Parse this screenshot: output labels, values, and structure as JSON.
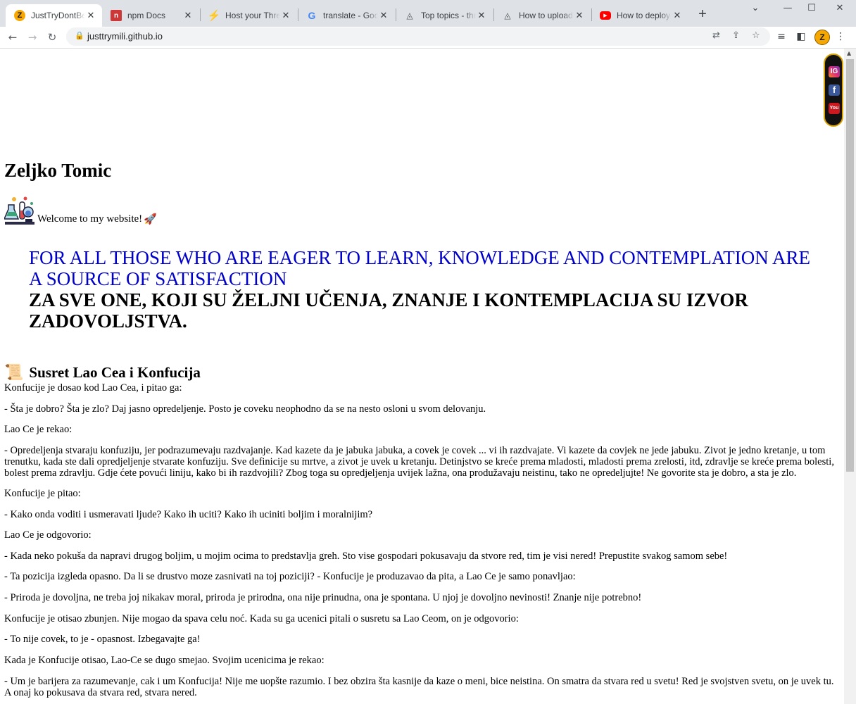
{
  "browser": {
    "tabs": [
      {
        "title": "JustTryDontBeShy",
        "active": true,
        "favicon": "z-logo-icon",
        "color": "#f6a800"
      },
      {
        "title": "npm Docs",
        "active": false,
        "favicon": "npm-icon",
        "color": "#cb3837"
      },
      {
        "title": "Host your Three.js",
        "active": false,
        "favicon": "lightning-icon",
        "color": "#f5a623"
      },
      {
        "title": "translate - Google",
        "active": false,
        "favicon": "google-icon",
        "color": "#4285f4"
      },
      {
        "title": "Top topics - three",
        "active": false,
        "favicon": "three-logo-icon",
        "color": "#555555"
      },
      {
        "title": "How to upload the",
        "active": false,
        "favicon": "three-logo-icon",
        "color": "#555555"
      },
      {
        "title": "How to deploy a T",
        "active": false,
        "favicon": "youtube-icon",
        "color": "#ff0000"
      }
    ],
    "url": "justtrymili.github.io",
    "profile_initial": "Z"
  },
  "page": {
    "name": "Zeljko Tomic",
    "welcome": "Welcome to my website!",
    "quote_en": "FOR ALL THOSE WHO ARE EAGER TO LEARN, KNOWLEDGE AND CONTEMPLATION ARE A SOURCE OF SATISFACTION",
    "quote_sr": "ZA SVE ONE, KOJI SU ŽELJNI UČENJA, ZNANJE I KONTEMPLACIJA SU IZVOR ZADOVOLJSTVA.",
    "section_title": "Susret Lao Cea i Konfucija",
    "paragraphs": [
      "Konfucije je dosao kod Lao Cea, i pitao ga:",
      "- Šta je dobro? Šta je zlo? Daj jasno opredeljenje. Posto je coveku neophodno da se na nesto osloni u svom delovanju.",
      "Lao Ce je rekao:",
      "- Opredeljenja stvaraju konfuziju, jer podrazumevaju razdvajanje. Kad kazete da je jabuka jabuka, a covek je covek ... vi ih razdvajate. Vi kazete da covjek ne jede jabuku. Zivot je jedno kretanje, u tom trenutku, kada ste dali opredjeljenje stvarate konfuziju. Sve definicije su mrtve, a zivot je uvek u kretanju. Detinjstvo se kreće prema mladosti, mladosti prema zrelosti, itd, zdravlje se kreće prema bolesti, bolest prema zdravlju. Gdje ćete povući liniju, kako bi ih razdvojili? Zbog toga su opredjeljenja uvijek lažna, ona produžavaju neistinu, tako ne opredeljujte! Ne govorite sta je dobro, a sta je zlo.",
      "Konfucije je pitao:",
      "- Kako onda voditi i usmeravati ljude? Kako ih uciti? Kako ih uciniti boljim i moralnijim?",
      "Lao Ce je odgovorio:",
      "- Kada neko pokuša da napravi drugog boljim, u mojim ocima to predstavlja greh. Sto vise gospodari pokusavaju da stvore red, tim je visi nered! Prepustite svakog samom sebe!",
      "- Ta pozicija izgleda opasno. Da li se drustvo moze zasnivati na toj poziciji? - Konfucije je produzavao da pita, a Lao Ce je samo ponavljao:",
      "- Priroda je dovoljna, ne treba joj nikakav moral, priroda je prirodna, ona nije prinudna, ona je spontana. U njoj je dovoljno nevinosti! Znanje nije potrebno!",
      "Konfucije je otisao zbunjen. Nije mogao da spava celu noć. Kada su ga ucenici pitali o susretu sa Lao Ceom, on je odgovorio:",
      "- To nije covek, to je - opasnost. Izbegavajte ga!",
      "Kada je Konfucije otisao, Lao-Ce se dugo smejao. Svojim ucenicima je rekao:",
      "- Um je barijera za razumevanje, cak i um Konfucija! Nije me uopšte razumio. I bez obzira šta kasnije da kaze o meni, bice neistina. On smatra da stvara red u svetu! Red je svojstven svetu, on je uvek tu. A onaj ko pokusava da stvara red, stvara nered."
    ],
    "social": [
      {
        "name": "instagram-icon",
        "label": "IG",
        "color": "#e1306c"
      },
      {
        "name": "facebook-icon",
        "label": "f",
        "color": "#3b5998"
      },
      {
        "name": "youtube-icon",
        "label": "You",
        "color": "#cc181e"
      }
    ]
  }
}
